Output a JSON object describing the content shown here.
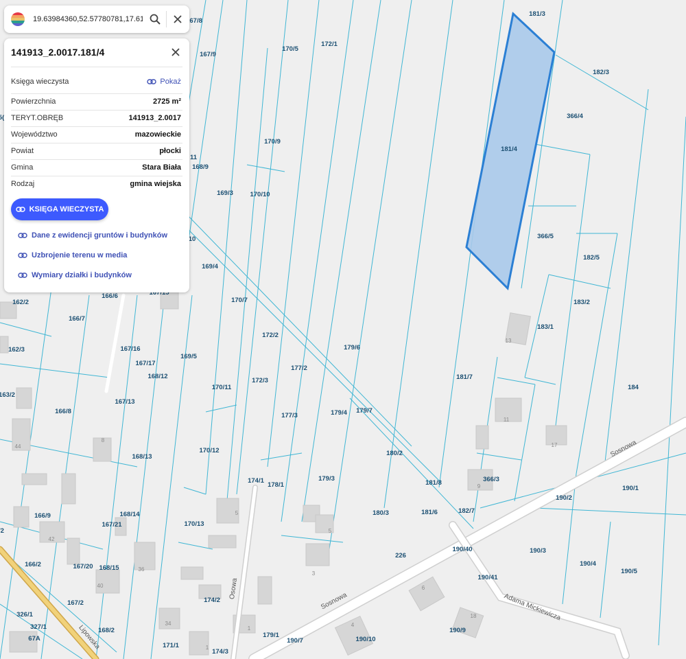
{
  "search": {
    "value": "19.63984360,52.57780781,17.61"
  },
  "panel": {
    "title": "141913_2.0017.181/4",
    "ksiega_label": "Księga wieczysta",
    "ksiega_link": "Pokaż",
    "rows": [
      {
        "label": "Powierzchnia",
        "value": "2725 m²"
      },
      {
        "label": "TERYT.OBRĘB",
        "value": "141913_2.0017"
      },
      {
        "label": "Województwo",
        "value": "mazowieckie"
      },
      {
        "label": "Powiat",
        "value": "płocki"
      },
      {
        "label": "Gmina",
        "value": "Stara Biała"
      },
      {
        "label": "Rodzaj",
        "value": "gmina wiejska"
      }
    ],
    "button_label": "KSIĘGA WIECZYSTA",
    "links": [
      "Dane z ewidencji gruntów i budynków",
      "Uzbrojenie terenu w media",
      "Wymiary działki i budynków"
    ]
  },
  "map": {
    "parcel_labels": [
      "181/3",
      "182/3",
      "366/4",
      "181/4",
      "366/5",
      "182/5",
      "183/2",
      "183/1",
      "184",
      "181/7",
      "179/6",
      "179/7",
      "179/4",
      "177/2",
      "177/3",
      "172/2",
      "172/3",
      "170/7",
      "170/11",
      "170/12",
      "170/13",
      "169/4",
      "169/5",
      "169/3",
      "170/10",
      "170/9",
      "170/5",
      "172/1",
      "167/8",
      "167/9",
      "168/9",
      "11",
      "10",
      "167/15",
      "166/6",
      "166/7",
      "162/2",
      "162/3",
      "163/2",
      "166/8",
      "167/16",
      "167/17",
      "168/12",
      "167/13",
      "168/13",
      "166/9",
      "168/14",
      "167/21",
      "166/2",
      "167/20",
      "168/15",
      "167/2",
      "326/1",
      "327/1",
      "168/2",
      "171/1",
      "174/1",
      "178/1",
      "179/3",
      "180/2",
      "181/8",
      "366/3",
      "181/6",
      "182/7",
      "180/3",
      "190/2",
      "190/1",
      "190/3",
      "190/4",
      "190/5",
      "190/40",
      "190/41",
      "226",
      "174/2",
      "179/1",
      "190/7",
      "190/10",
      "190/9",
      "174/3",
      "/2",
      "5(",
      "67A"
    ],
    "house_numbers": [
      "13",
      "11",
      "17",
      "9",
      "8",
      "44",
      "42",
      "40",
      "36",
      "5",
      "5",
      "3",
      "34",
      "1",
      "1",
      "6",
      "4",
      "18"
    ],
    "streets": [
      "Sosnowa",
      "Sosnowa",
      "Adama Mickiewicza",
      "Lipowska",
      "Osowa"
    ],
    "selected_parcel": "181/4",
    "colors": {
      "selected_fill": "#a9c9ea",
      "selected_stroke": "#2b7fd4",
      "parcel_line": "#3fb6d4",
      "road": "#ffffff",
      "accent": "#3d5afe"
    }
  }
}
